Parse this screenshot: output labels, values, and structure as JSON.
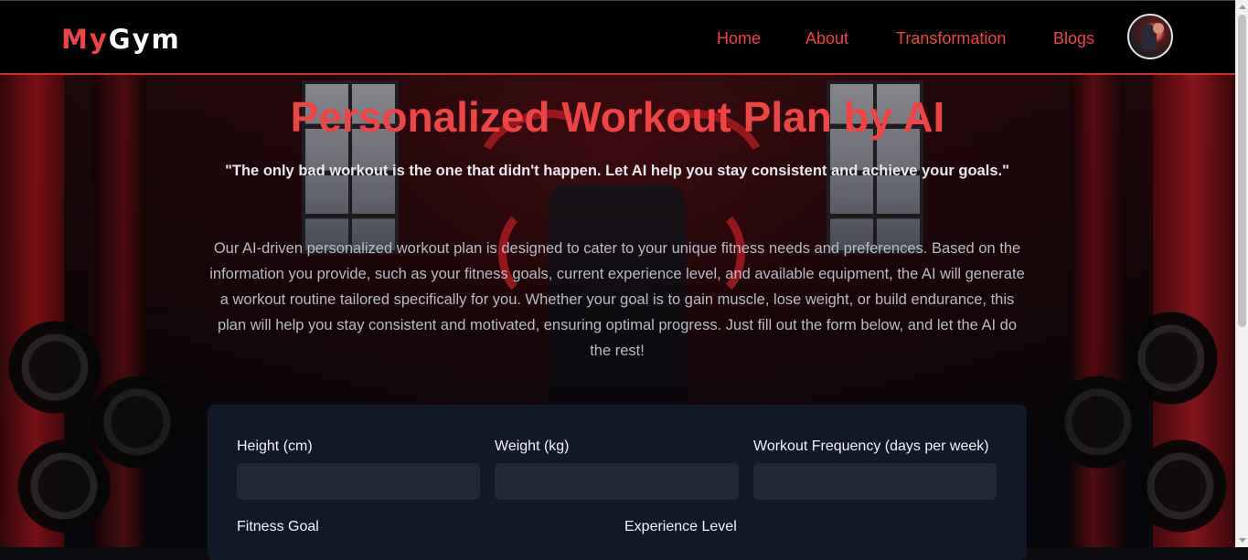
{
  "navbar": {
    "logo_part1": "My",
    "logo_part2": "Gym",
    "links": [
      {
        "label": "Home"
      },
      {
        "label": "About"
      },
      {
        "label": "Transformation"
      },
      {
        "label": "Blogs"
      }
    ],
    "avatar_icon": "user-avatar-icon"
  },
  "hero": {
    "title": "Personalized Workout Plan by AI",
    "quote": "\"The only bad workout is the one that didn't happen. Let AI help you stay consistent and achieve your goals.\"",
    "description": "Our AI-driven personalized workout plan is designed to cater to your unique fitness needs and preferences. Based on the information you provide, such as your fitness goals, current experience level, and available equipment, the AI will generate a workout routine tailored specifically for you. Whether your goal is to gain muscle, lose weight, or build endurance, this plan will help you stay consistent and motivated, ensuring optimal progress. Just fill out the form below, and let the AI do the rest!"
  },
  "form": {
    "height_label": "Height (cm)",
    "height_value": "",
    "weight_label": "Weight (kg)",
    "weight_value": "",
    "frequency_label": "Workout Frequency (days per week)",
    "frequency_value": "",
    "goal_label": "Fitness Goal",
    "experience_label": "Experience Level"
  },
  "colors": {
    "accent": "#ef4444",
    "navbar_bg": "#000000",
    "card_bg": "#111827",
    "input_bg": "#1f2937"
  }
}
